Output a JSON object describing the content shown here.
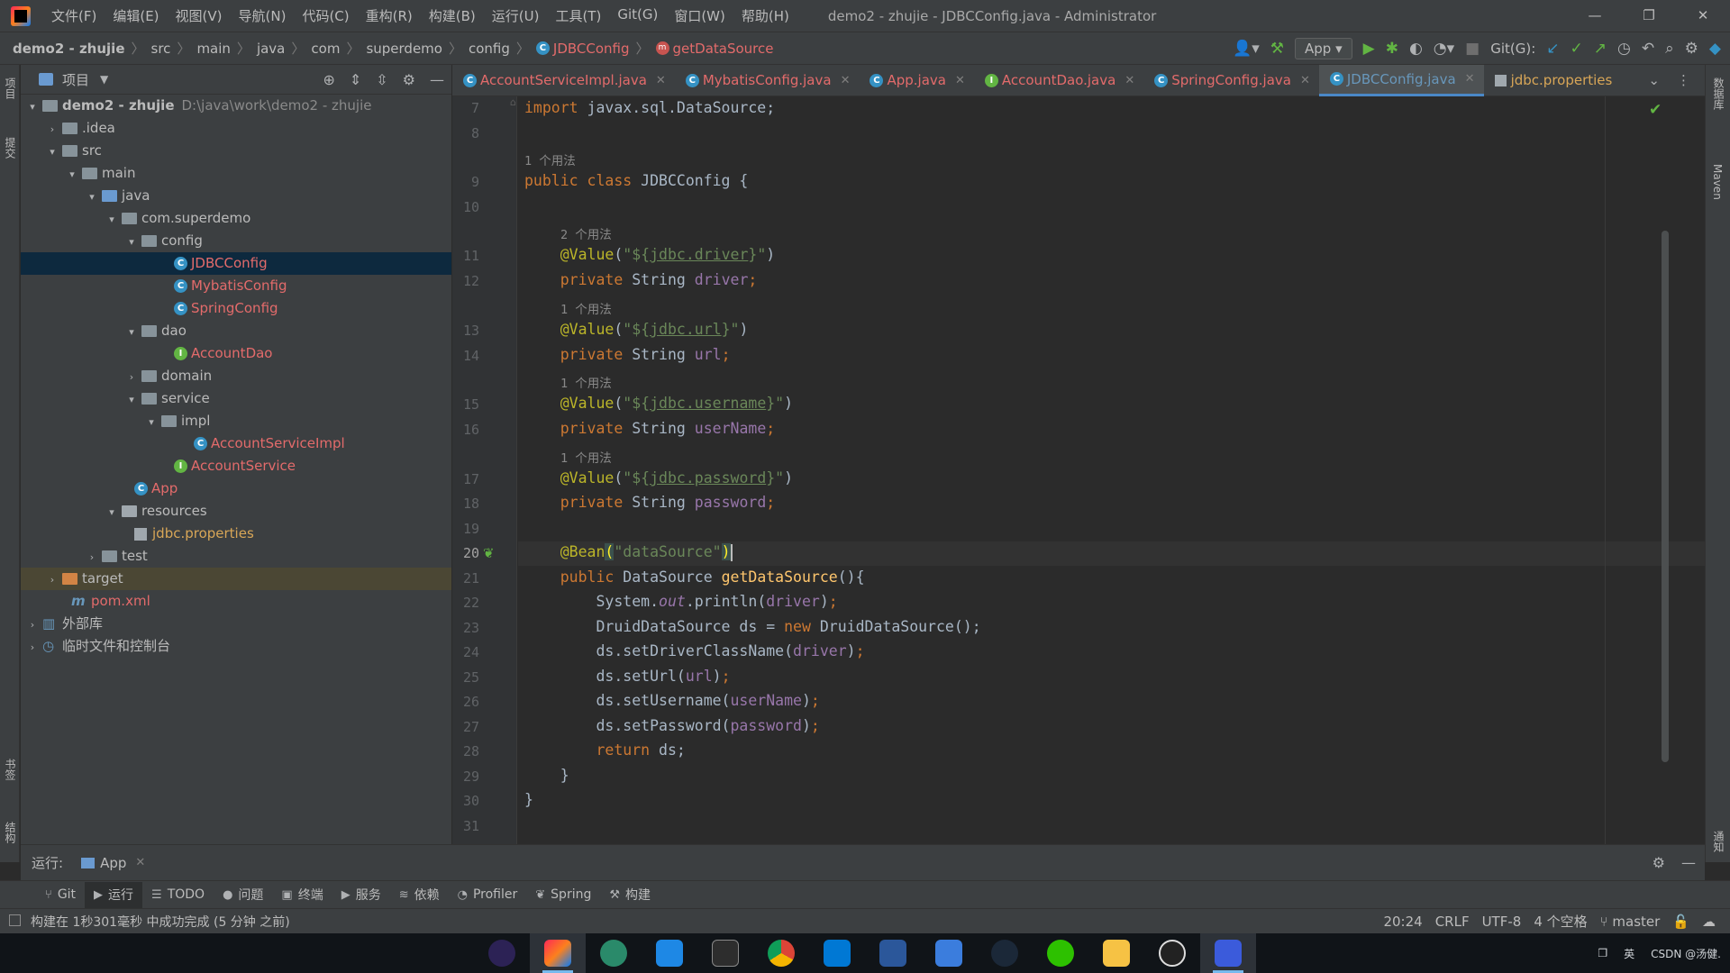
{
  "title_bar": {
    "menu": [
      "文件(F)",
      "编辑(E)",
      "视图(V)",
      "导航(N)",
      "代码(C)",
      "重构(R)",
      "构建(B)",
      "运行(U)",
      "工具(T)",
      "Git(G)",
      "窗口(W)",
      "帮助(H)"
    ],
    "window_title": "demo2 - zhujie - JDBCConfig.java - Administrator",
    "buttons": [
      "—",
      "❐",
      "✕"
    ]
  },
  "nav_bar": {
    "crumbs": [
      "demo2 - zhujie",
      "src",
      "main",
      "java",
      "com",
      "superdemo",
      "config",
      "JDBCConfig",
      "getDataSource"
    ],
    "run_config": "App",
    "git_label": "Git(G):"
  },
  "left_stripe": {
    "project": "项目",
    "commit": "提交",
    "bookmarks": "书签",
    "structure": "结构"
  },
  "right_stripe": {
    "database": "数据库",
    "maven": "Maven",
    "notifications": "通知"
  },
  "project_panel": {
    "title": "项目",
    "tree": [
      {
        "label": "demo2 - zhujie",
        "path": "D:\\java\\work\\demo2 - zhujie"
      },
      {
        "label": ".idea"
      },
      {
        "label": "src"
      },
      {
        "label": "main"
      },
      {
        "label": "java"
      },
      {
        "label": "com.superdemo"
      },
      {
        "label": "config"
      },
      {
        "label": "JDBCConfig"
      },
      {
        "label": "MybatisConfig"
      },
      {
        "label": "SpringConfig"
      },
      {
        "label": "dao"
      },
      {
        "label": "AccountDao"
      },
      {
        "label": "domain"
      },
      {
        "label": "service"
      },
      {
        "label": "impl"
      },
      {
        "label": "AccountServiceImpl"
      },
      {
        "label": "AccountService"
      },
      {
        "label": "App"
      },
      {
        "label": "resources"
      },
      {
        "label": "jdbc.properties"
      },
      {
        "label": "test"
      },
      {
        "label": "target"
      },
      {
        "label": "pom.xml"
      },
      {
        "label": "外部库"
      },
      {
        "label": "临时文件和控制台"
      }
    ]
  },
  "editor_tabs": [
    {
      "label": "AccountServiceImpl.java",
      "active": false
    },
    {
      "label": "MybatisConfig.java",
      "active": false
    },
    {
      "label": "App.java",
      "active": false
    },
    {
      "label": "AccountDao.java",
      "active": false
    },
    {
      "label": "SpringConfig.java",
      "active": false
    },
    {
      "label": "JDBCConfig.java",
      "active": true
    },
    {
      "label": "jdbc.properties",
      "active": false
    }
  ],
  "editor": {
    "line_numbers": [
      "7",
      "8",
      "9",
      "10",
      "11",
      "12",
      "13",
      "14",
      "15",
      "16",
      "17",
      "18",
      "19",
      "20",
      "21",
      "22",
      "23",
      "24",
      "25",
      "26",
      "27",
      "28",
      "29",
      "30",
      "31"
    ],
    "hints": {
      "one_usage": "1 个用法",
      "two_usages": "2 个用法"
    },
    "code": {
      "import_kw": "import",
      "import_pkg": " javax.sql.DataSource;",
      "class_decl_kw": "public class",
      "class_name": " JDBCConfig {",
      "annotation": "@Value",
      "driver_key": "jdbc.driver",
      "url_key": "jdbc.url",
      "username_key": "jdbc.username",
      "password_key": "jdbc.password",
      "private_kw": "private",
      "string_type": " String ",
      "driver_field": "driver",
      "url_field": "url",
      "username_field": "userName",
      "password_field": "password",
      "bean_annotation": "@Bean",
      "bean_name": "\"dataSource\"",
      "public_kw": "public",
      "ds_type": " DataSource ",
      "method_name": "getDataSource",
      "sysout_pre": "System.",
      "sysout_out": "out",
      "sysout_post": ".println(",
      "druid_decl": "DruidDataSource ds = ",
      "new_kw": "new",
      "druid_ctor": " DruidDataSource();",
      "set_driver": "ds.setDriverClassName(",
      "set_url": "ds.setUrl(",
      "set_username": "ds.setUsername(",
      "set_password": "ds.setPassword(",
      "return_kw": "return",
      "return_val": " ds;"
    }
  },
  "run_bar": {
    "label": "运行:",
    "config": "App"
  },
  "tool_tabs": [
    "Git",
    "运行",
    "TODO",
    "问题",
    "终端",
    "服务",
    "依赖",
    "Profiler",
    "Spring",
    "构建"
  ],
  "status_bar": {
    "message": "构建在 1秒301毫秒 中成功完成 (5 分钟 之前)",
    "position": "20:24",
    "line_sep": "CRLF",
    "encoding": "UTF-8",
    "indent": "4 个空格",
    "branch": "master"
  },
  "taskbar": {
    "apps": [
      "eclipse",
      "intellij-idea",
      "edge-dev",
      "remote-desktop",
      "terminal",
      "chrome",
      "vscode",
      "word",
      "todo",
      "steam",
      "wechat",
      "file-explorer",
      "davinci",
      "media-player"
    ],
    "tray_text": "CSDN @汤健."
  },
  "colors": {
    "accent": "#4a88c7",
    "keyword": "#cc7832",
    "annotation": "#bbb529",
    "string": "#6a8759",
    "field": "#9876aa",
    "method": "#ffc66d",
    "selection": "#0d293e"
  }
}
